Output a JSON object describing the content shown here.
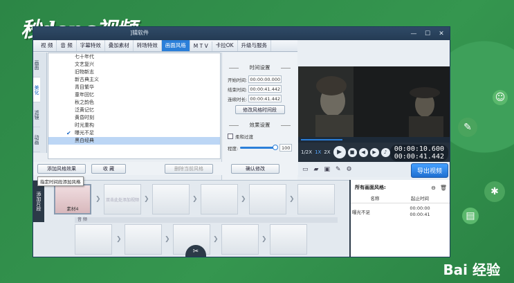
{
  "overlay": {
    "logo_text": "秒dong视频",
    "baidu_text": "Bai 经验"
  },
  "window": {
    "title": "]辑软件",
    "minimize": "—",
    "maximize": "☐",
    "close": "✕"
  },
  "tabs": [
    "视 频",
    "音 频",
    "字幕特效",
    "叠加素材",
    "转场特效",
    "画面风格",
    "M T V",
    "卡拉OK",
    "升级与服务"
  ],
  "active_tab": 5,
  "left_rail": [
    "画面",
    "美化",
    "滤镜",
    "动画"
  ],
  "style_list": {
    "items": [
      "七十年代",
      "文艺复兴",
      "旧物新志",
      "新古典主义",
      "青目繁华",
      "童年回忆",
      "秋之韵色",
      "泛黄记忆",
      "黄昏时刻",
      "时光重构",
      "曝光不足",
      "黑白经典"
    ],
    "checked_index": 10,
    "selected_index": 11
  },
  "time_settings": {
    "title": "时间设置",
    "start_label": "开始时间:",
    "start_value": "00:00:00.000",
    "end_label": "结束时间:",
    "end_value": "00:00:41.442",
    "duration_label": "连续时长:",
    "duration_value": "00:00:41.442",
    "modify_button": "修改风格时间段"
  },
  "effect_settings": {
    "title": "效果设置",
    "fade_label": "柔和过渡",
    "degree_label": "程度:",
    "degree_value": "100",
    "degree_fraction": 1.0
  },
  "actions": {
    "add_style": "添加风格效果",
    "collect": "收 藏",
    "delete_current": "删除当前风格",
    "confirm": "确认修改",
    "tooltip": "指定时间段添加风格"
  },
  "player": {
    "speeds": [
      "1/2X",
      "1X",
      "2X"
    ],
    "active_speed": 1,
    "time_current": "00:00:10.600",
    "time_total": "00:00:41.442",
    "progress_fraction": 0.28,
    "export_button": "导出视频"
  },
  "timeline": {
    "side_label": "添加片段",
    "clip_name": "素材4",
    "placeholder_clip": "双击此处添加视频",
    "audio_label": "音 频"
  },
  "style_panel": {
    "title": "所有画面风格:",
    "col_name": "名称",
    "col_time": "起止时间",
    "rows": [
      {
        "name": "曝光不足",
        "start": "00:00:00",
        "end": "00:00:41"
      }
    ]
  }
}
